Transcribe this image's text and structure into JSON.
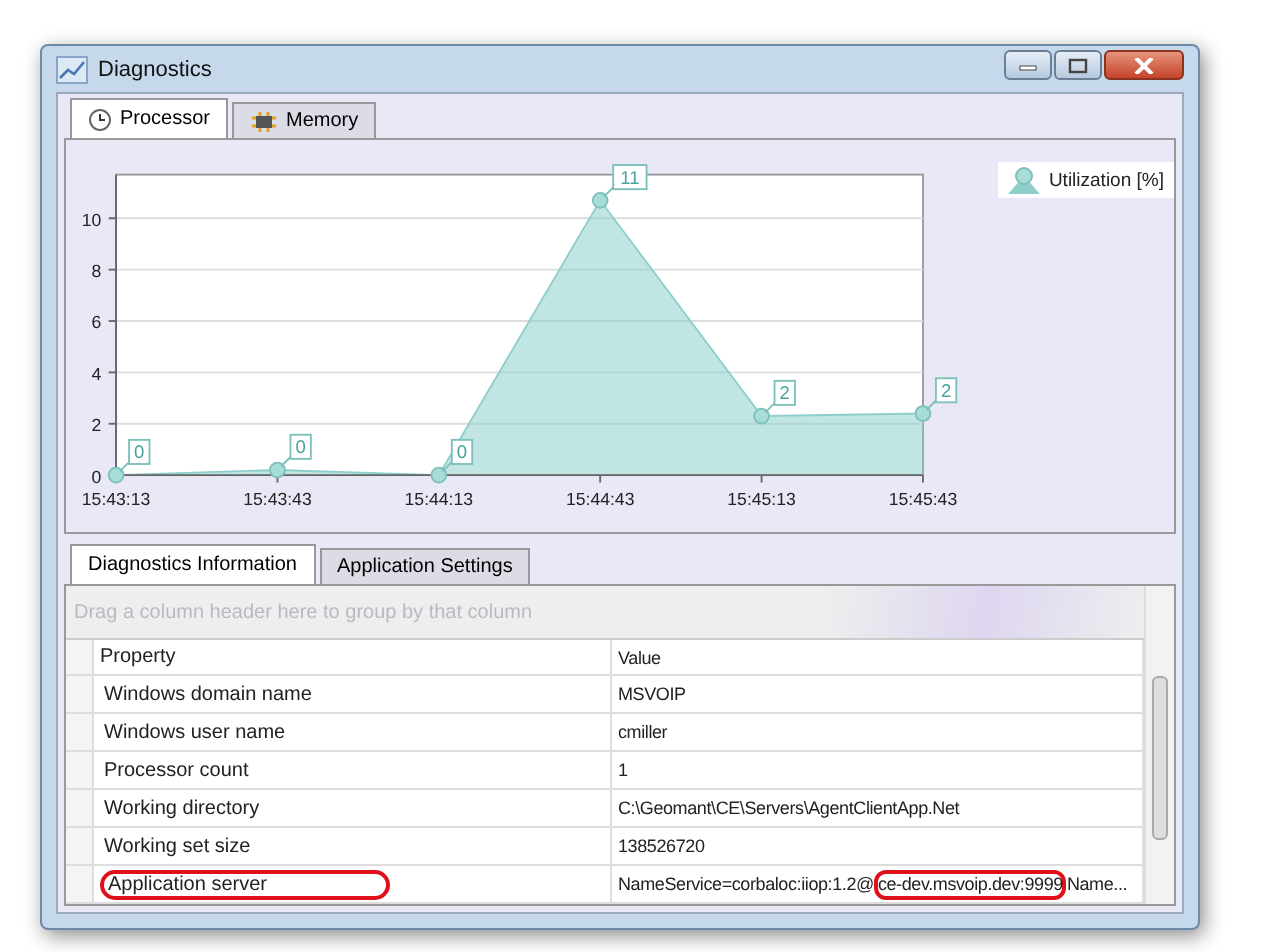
{
  "window": {
    "title": "Diagnostics"
  },
  "top_tabs": [
    {
      "label": "Processor",
      "selected": true
    },
    {
      "label": "Memory",
      "selected": false
    }
  ],
  "chart": {
    "chart_data": {
      "type": "area",
      "grid": true,
      "categories": [
        "15:43:13",
        "15:43:43",
        "15:44:13",
        "15:44:43",
        "15:45:13",
        "15:45:43"
      ],
      "series": [
        {
          "name": "Utilization [%]",
          "color": "#8ecfcb",
          "values": [
            0,
            0.2,
            0,
            10.7,
            2.3,
            2.4
          ]
        }
      ],
      "ylim": [
        0,
        11.7
      ],
      "yticks": [
        0,
        2,
        4,
        6,
        8,
        10
      ],
      "value_labels": [
        "0",
        "0",
        "0",
        "11",
        "2",
        "2"
      ]
    }
  },
  "bottom_tabs": [
    {
      "label": "Diagnostics Information",
      "selected": true
    },
    {
      "label": "Application Settings",
      "selected": false
    }
  ],
  "grid": {
    "group_hint": "Drag a column header here to group by that column",
    "columns": [
      "Property",
      "Value"
    ],
    "rows": [
      {
        "property": "Windows domain name",
        "value_parts": [
          {
            "text": "MSVOIP",
            "circled": false
          }
        ],
        "circled": false
      },
      {
        "property": "Windows user name",
        "value_parts": [
          {
            "text": "cmiller",
            "circled": false
          }
        ],
        "circled": false
      },
      {
        "property": "Processor count",
        "value_parts": [
          {
            "text": "1",
            "circled": false
          }
        ],
        "circled": false
      },
      {
        "property": "Working directory",
        "value_parts": [
          {
            "text": "C:\\Geomant\\CE\\Servers\\AgentClientApp.Net",
            "circled": false
          }
        ],
        "circled": false
      },
      {
        "property": "Working set size",
        "value_parts": [
          {
            "text": "138526720",
            "circled": false
          }
        ],
        "circled": false
      },
      {
        "property": "Application server",
        "value_parts": [
          {
            "text": "NameService=corbaloc:iiop:1.2@",
            "circled": false
          },
          {
            "text": "ce-dev.msvoip.dev:9999",
            "circled": true
          },
          {
            "text": "Name...",
            "circled": false
          }
        ],
        "circled": true
      }
    ]
  }
}
